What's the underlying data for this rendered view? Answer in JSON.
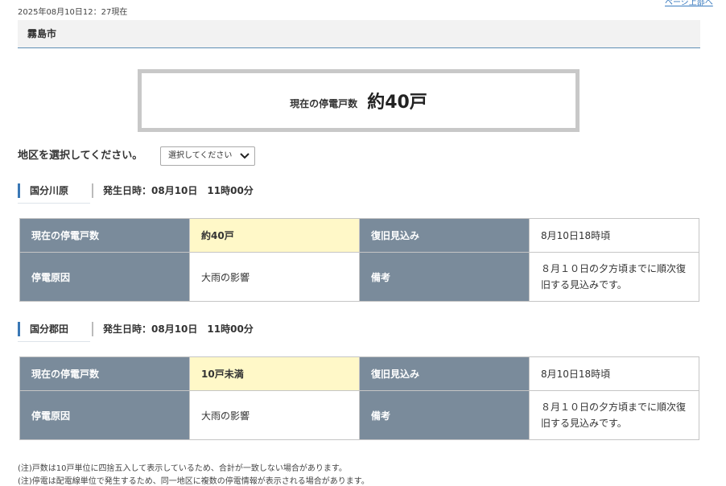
{
  "header": {
    "timestamp": "2025年08月10日12：27現在",
    "top_link": "ページ上部へ"
  },
  "city": {
    "name": "霧島市"
  },
  "total": {
    "label": "現在の停電戸数",
    "value": "約40戸"
  },
  "area_select": {
    "label": "地区を選択してください。",
    "selected": "選択してください"
  },
  "sections": [
    {
      "name": "国分川原",
      "occurred": "発生日時：08月10日　11時00分",
      "rows": [
        {
          "h1": "現在の停電戸数",
          "v1": "約40戸",
          "h2": "復旧見込み",
          "v2": "8月10日18時頃"
        },
        {
          "h1": "停電原因",
          "v1": "大雨の影響",
          "h2": "備考",
          "v2": "８月１０日の夕方頃までに順次復旧する見込みです。"
        }
      ]
    },
    {
      "name": "国分郡田",
      "occurred": "発生日時：08月10日　11時00分",
      "rows": [
        {
          "h1": "現在の停電戸数",
          "v1": "10戸未満",
          "h2": "復旧見込み",
          "v2": "8月10日18時頃"
        },
        {
          "h1": "停電原因",
          "v1": "大雨の影響",
          "h2": "備考",
          "v2": "８月１０日の夕方頃までに順次復旧する見込みです。"
        }
      ]
    }
  ],
  "footnotes": [
    "(注)戸数は10戸単位に四捨五入して表示しているため、合計が一致しない場合があります。",
    "(注)停電は配電線単位で発生するため、同一地区に複数の停電情報が表示される場合があります。"
  ]
}
